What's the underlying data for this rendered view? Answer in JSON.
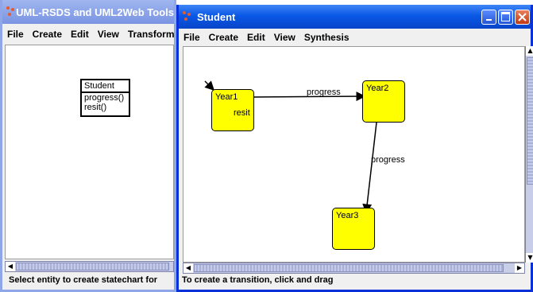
{
  "left_window": {
    "title": "UML-RSDS and UML2Web Tools",
    "menu": [
      "File",
      "Create",
      "Edit",
      "View",
      "Transform"
    ],
    "class_box": {
      "name": "Student",
      "operations": [
        "progress()",
        "resit()"
      ]
    },
    "status": "Select entity to create statechart for"
  },
  "right_window": {
    "title": "Student",
    "menu": [
      "File",
      "Create",
      "Edit",
      "View",
      "Synthesis"
    ],
    "states": [
      "Year1",
      "Year2",
      "Year3"
    ],
    "transitions": [
      {
        "from": "Year1",
        "to": "Year2",
        "label": "progress"
      },
      {
        "from": "Year2",
        "to": "Year3",
        "label": "progress"
      },
      {
        "from": "Year1",
        "to": "Year1",
        "label": "resit"
      }
    ],
    "status": "To create a transition, click and drag",
    "controls": [
      "minimize-icon",
      "maximize-icon",
      "close-icon"
    ]
  },
  "colors": {
    "titlebar_active": "#0a58e6",
    "titlebar_inactive": "#7d9ae6",
    "state_fill": "#ffff00",
    "window_frame": "#0831d9"
  }
}
